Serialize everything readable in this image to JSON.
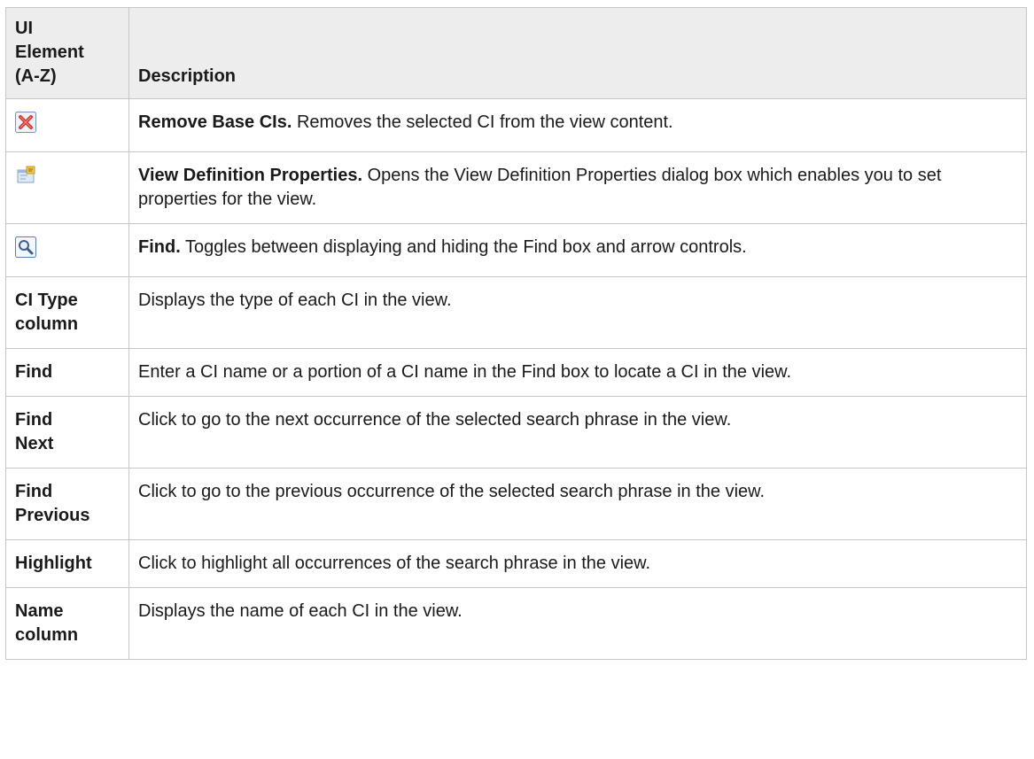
{
  "table": {
    "headers": {
      "element_lines": [
        "UI",
        "Element",
        "(A-Z)"
      ],
      "description": "Description"
    },
    "rows": [
      {
        "icon": "remove-red-x-icon",
        "term": "Remove Base CIs.",
        "text": " Removes the selected CI from the view content."
      },
      {
        "icon": "view-properties-icon",
        "term": "View Definition Properties.",
        "text": " Opens the View Definition Properties dialog box which enables you to set properties for the view."
      },
      {
        "icon": "find-magnifier-icon",
        "term": "Find.",
        "text": " Toggles between displaying and hiding the Find box and arrow controls."
      },
      {
        "name_lines": [
          "CI Type",
          "column"
        ],
        "text": "Displays the type of each CI in the view."
      },
      {
        "name_lines": [
          "Find"
        ],
        "text": "Enter a CI name or a portion of a CI name in the Find box to locate a CI in the view."
      },
      {
        "name_lines": [
          "Find",
          "Next"
        ],
        "text": "Click to go to the next occurrence of the selected search phrase in the view."
      },
      {
        "name_lines": [
          "Find",
          "Previous"
        ],
        "text": "Click to go to the previous occurrence of the selected search phrase in the view."
      },
      {
        "name_lines": [
          "Highlight"
        ],
        "text": "Click to highlight all occurrences of the search phrase in the view."
      },
      {
        "name_lines": [
          "Name",
          "column"
        ],
        "text": "Displays the name of each CI in the view."
      }
    ]
  },
  "colors": {
    "header_bg": "#ededed",
    "border": "#c6c6c6",
    "text": "#1a1a1a",
    "remove_icon_red": "#d9322a"
  }
}
